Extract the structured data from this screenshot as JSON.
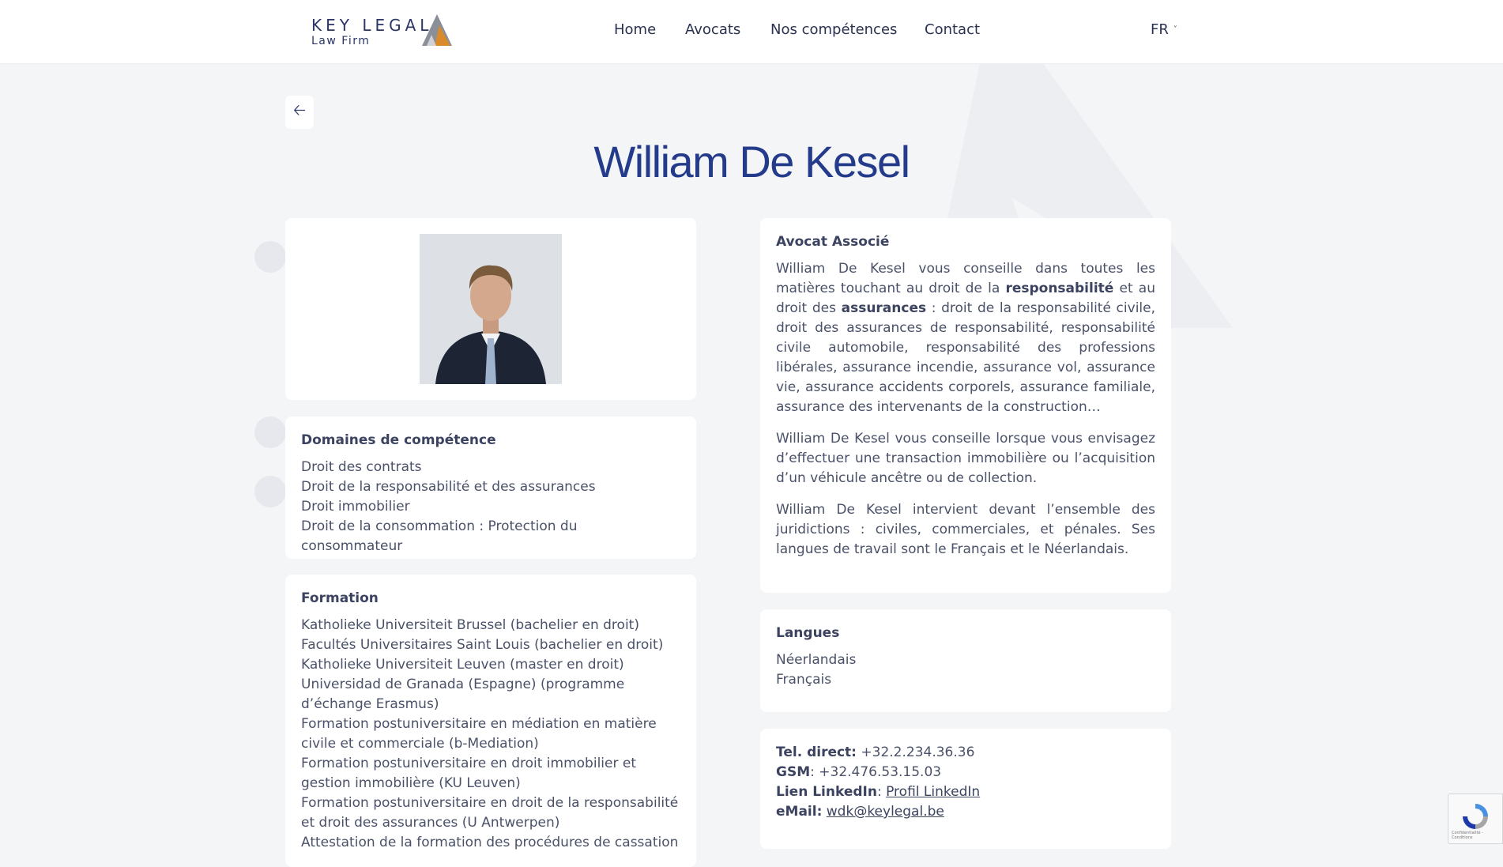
{
  "header": {
    "logo_line1": "KEY LEGAL",
    "logo_line2": "Law Firm",
    "nav": [
      "Home",
      "Avocats",
      "Nos compétences",
      "Contact"
    ],
    "lang": "FR"
  },
  "page": {
    "title": "William De Kesel"
  },
  "competences": {
    "heading": "Domaines de compétence",
    "items": [
      "Droit des contrats",
      "Droit de la responsabilité et des assurances",
      "Droit immobilier",
      "Droit de la consommation : Protection du consommateur"
    ]
  },
  "formation": {
    "heading": "Formation",
    "items": [
      "Katholieke Universiteit Brussel (bachelier en droit)",
      "Facultés Universitaires Saint Louis (bachelier en droit)",
      "Katholieke Universiteit Leuven (master en droit)",
      "Universidad de Granada (Espagne) (programme d’échange Erasmus)",
      "Formation postuniversitaire en médiation en matière civile et commerciale (b-Mediation)",
      "Formation postuniversitaire en droit immobilier et gestion immobilière (KU Leuven)",
      "Formation postuniversitaire en droit de la responsabilité et droit des assurances (U Antwerpen)",
      "Attestation de la formation des procédures de cassation"
    ]
  },
  "bio": {
    "role": "Avocat Associé",
    "p1_a": "William De Kesel vous conseille dans toutes les matières touchant au droit de la ",
    "p1_b1": "responsabilité",
    "p1_c": " et au droit des ",
    "p1_b2": "assurances",
    "p1_d": " : droit de la responsabilité civile, droit des assurances de responsabilité, responsabilité civile automobile, responsabilité des professions libérales, assurance incendie, assurance vol, assurance vie, assurance accidents corporels, assurance familiale, assurance des intervenants de la construction…",
    "p2": "William De Kesel vous conseille lorsque vous envisagez d’effectuer une transaction immobilière ou l’acquisition d’un véhicule ancêtre ou de collection.",
    "p3": "William De Kesel intervient devant l’ensemble des juridictions : civiles, commerciales, et pénales. Ses langues de travail sont le Français et le Néerlandais."
  },
  "langues": {
    "heading": "Langues",
    "items": [
      "Néerlandais",
      "Français"
    ]
  },
  "contact": {
    "tel_label": "Tel. direct:",
    "tel_value": " +32.2.234.36.36",
    "gsm_label": "GSM",
    "gsm_value": ": +32.476.53.15.03",
    "linkedin_label": "Lien LinkedIn",
    "linkedin_sep": ": ",
    "linkedin_link": "Profil LinkedIn ",
    "email_label": "eMail:",
    "email_link": "wdk@keylegal.be"
  },
  "recaptcha": {
    "text": "Confidentialité - Conditions"
  },
  "colors": {
    "title": "#243a8a",
    "background": "#f4f5f7",
    "card": "#ffffff",
    "logo_orange": "#d98a2b",
    "logo_grey": "#8a8f98"
  }
}
